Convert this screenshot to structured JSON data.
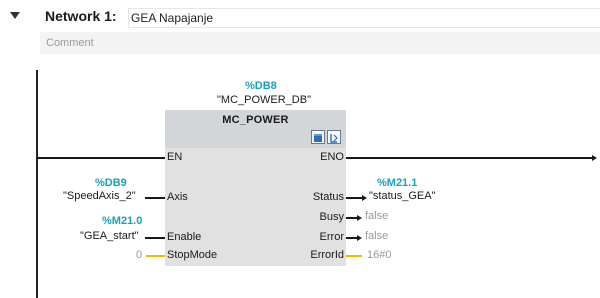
{
  "network": {
    "label": "Network 1:",
    "title": "GEA Napajanje",
    "comment_placeholder": "Comment"
  },
  "block": {
    "instance_address": "%DB8",
    "instance_name": "\"MC_POWER_DB\"",
    "type_name": "MC_POWER",
    "icons": [
      "db-icon",
      "block-info-icon"
    ]
  },
  "inputs": {
    "en": "EN",
    "axis": {
      "pin": "Axis",
      "address": "%DB9",
      "operand": "\"SpeedAxis_2\""
    },
    "enable": {
      "pin": "Enable",
      "address": "%M21.0",
      "operand": "\"GEA_start\""
    },
    "stopmode": {
      "pin": "StopMode",
      "value": "0"
    }
  },
  "outputs": {
    "eno": "ENO",
    "status": {
      "pin": "Status",
      "address": "%M21.1",
      "operand": "\"status_GEA\""
    },
    "busy": {
      "pin": "Busy",
      "value": "false"
    },
    "error": {
      "pin": "Error",
      "value": "false"
    },
    "errorid": {
      "pin": "ErrorId",
      "value": "16#0"
    }
  },
  "colors": {
    "address": "#1aa0b8",
    "constant_wire": "#f5b700",
    "block_body": "#e1e1e1",
    "block_header": "#d3d6d9"
  }
}
